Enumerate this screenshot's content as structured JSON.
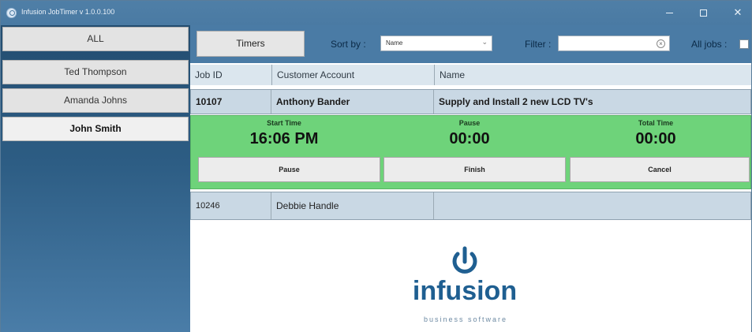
{
  "window": {
    "title": "Infusion JobTimer v 1.0.0.100",
    "controls": {
      "minimize": "–",
      "maximize": "□",
      "close": "✕"
    }
  },
  "sidebar": {
    "items": [
      {
        "label": "ALL",
        "active": false
      },
      {
        "label": "Ted Thompson",
        "active": false
      },
      {
        "label": "Amanda Johns",
        "active": false
      },
      {
        "label": "John Smith",
        "active": true
      }
    ]
  },
  "toolbar": {
    "timers_label": "Timers",
    "sort_by_label": "Sort by :",
    "sort_by_value": "Name",
    "filter_label": "Filter :",
    "filter_value": "",
    "all_jobs_label": "All jobs :",
    "all_jobs_checked": false
  },
  "grid": {
    "columns": [
      "Job ID",
      "Customer Account",
      "Name"
    ],
    "rows": [
      {
        "job_id": "10107",
        "customer": "Anthony Bander",
        "name": "Supply and Install 2 new LCD TV's",
        "expanded": true
      },
      {
        "job_id": "10246",
        "customer": "Debbie Handle",
        "name": "",
        "expanded": false
      }
    ]
  },
  "timer": {
    "start_time_label": "Start Time",
    "start_time_value": "16:06 PM",
    "pause_label": "Pause",
    "pause_value": "00:00",
    "total_time_label": "Total Time",
    "total_time_value": "00:00",
    "buttons": {
      "pause": "Pause",
      "finish": "Finish",
      "cancel": "Cancel"
    }
  },
  "logo": {
    "brand": "infusion",
    "tagline": "business software",
    "colors": {
      "brand": "#1f5f91",
      "accent": "#6ed37a"
    }
  }
}
